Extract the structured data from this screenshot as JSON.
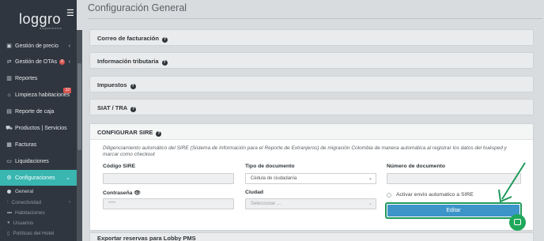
{
  "sidebar": {
    "logo": "loggro",
    "logo_sub": "alojamientos",
    "items": [
      {
        "label": "Gestión de precio",
        "icon": "tag-icon",
        "badge": ""
      },
      {
        "label": "Gestión de OTAs",
        "icon": "swap-icon",
        "badge": "0"
      },
      {
        "label": "Reportes",
        "icon": "bar-chart-icon",
        "badge": ""
      },
      {
        "label": "Limpieza habitaciones",
        "icon": "broom-icon",
        "badge": "12"
      },
      {
        "label": "Reporte de caja",
        "icon": "cash-icon",
        "badge": ""
      },
      {
        "label": "Productos | Servicios",
        "icon": "cart-icon",
        "badge": ""
      },
      {
        "label": "Facturas",
        "icon": "invoice-icon",
        "badge": ""
      },
      {
        "label": "Liquidaciones",
        "icon": "money-icon",
        "badge": ""
      },
      {
        "label": "Configuraciones",
        "icon": "gear-icon",
        "badge": ""
      }
    ],
    "subitems": [
      {
        "label": "General"
      },
      {
        "label": "Conectividad"
      },
      {
        "label": "Habitaciones"
      },
      {
        "label": "Usuarios"
      },
      {
        "label": "Políticas del Hotel"
      }
    ]
  },
  "page": {
    "title": "Configuración General"
  },
  "sections": [
    {
      "label": "Correo de facturación"
    },
    {
      "label": "Información tributaria"
    },
    {
      "label": "Impuestos"
    },
    {
      "label": "SIAT / TRA"
    }
  ],
  "sire": {
    "header": "CONFIGURAR SIRE",
    "description": "Diligenciamiento automático del SIRE (Sistema de Información para el Reporte de Extranjeros) de migración Colombia de manera automática al registrar los datos del huésped y marcar como checkout",
    "codigo_label": "Código SIRE",
    "codigo_value": "",
    "tipo_label": "Tipo de documento",
    "tipo_value": "Cédula de ciudadanía",
    "numero_label": "Número de documento",
    "numero_value": "",
    "password_label": "Contraseña",
    "password_value": "****",
    "ciudad_label": "Ciudad",
    "ciudad_placeholder": "Seleccionar ...",
    "auto_label": "Activar envío automatico a SIRE",
    "edit_button": "Editar"
  },
  "bottom_section": {
    "label": "Exportar reservas para Lobby PMS"
  },
  "colors": {
    "sidebar": "#2f3640",
    "active": "#39b6b0",
    "button": "#3d94c9",
    "highlight": "#1f9a5a"
  }
}
